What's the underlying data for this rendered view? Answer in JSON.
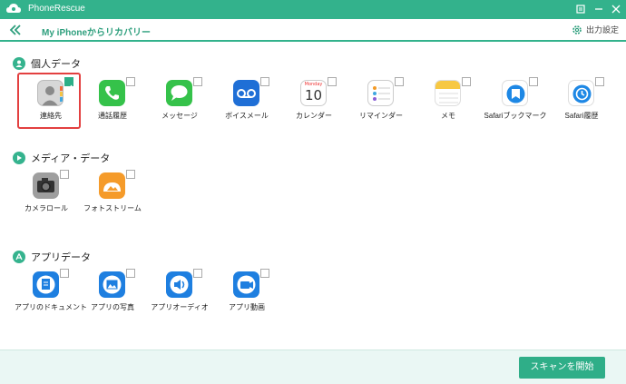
{
  "app": {
    "title": "PhoneRescue",
    "brand_color": "#33b28c"
  },
  "toolbar": {
    "breadcrumb": "My iPhoneからリカバリー",
    "settings_label": "出力設定"
  },
  "sections": [
    {
      "title": "個人データ",
      "icon": "person-icon",
      "items": [
        {
          "label": "連絡先",
          "icon": "contacts-icon",
          "checked": true
        },
        {
          "label": "通話履歴",
          "icon": "phone-icon",
          "checked": false
        },
        {
          "label": "メッセージ",
          "icon": "messages-icon",
          "checked": false
        },
        {
          "label": "ボイスメール",
          "icon": "voicemail-icon",
          "checked": false
        },
        {
          "label": "カレンダー",
          "icon": "calendar-icon",
          "checked": false,
          "calendar_month": "Monday",
          "calendar_day": "10"
        },
        {
          "label": "リマインダー",
          "icon": "reminders-icon",
          "checked": false
        },
        {
          "label": "メモ",
          "icon": "notes-icon",
          "checked": false
        },
        {
          "label": "Safariブックマーク",
          "icon": "safari-bookmark-icon",
          "checked": false
        },
        {
          "label": "Safari履歴",
          "icon": "safari-history-icon",
          "checked": false
        }
      ]
    },
    {
      "title": "メディア・データ",
      "icon": "play-icon",
      "items": [
        {
          "label": "カメラロール",
          "icon": "camera-icon",
          "checked": false
        },
        {
          "label": "フォトストリーム",
          "icon": "photostream-icon",
          "checked": false
        }
      ]
    },
    {
      "title": "アプリデータ",
      "icon": "appstore-icon",
      "items": [
        {
          "label": "アプリのドキュメント",
          "icon": "app-document-icon",
          "checked": false
        },
        {
          "label": "アプリの写真",
          "icon": "app-photo-icon",
          "checked": false
        },
        {
          "label": "アプリオーディオ",
          "icon": "app-audio-icon",
          "checked": false
        },
        {
          "label": "アプリ動画",
          "icon": "app-video-icon",
          "checked": false
        }
      ]
    }
  ],
  "footer": {
    "scan_button": "スキャンを開始"
  }
}
